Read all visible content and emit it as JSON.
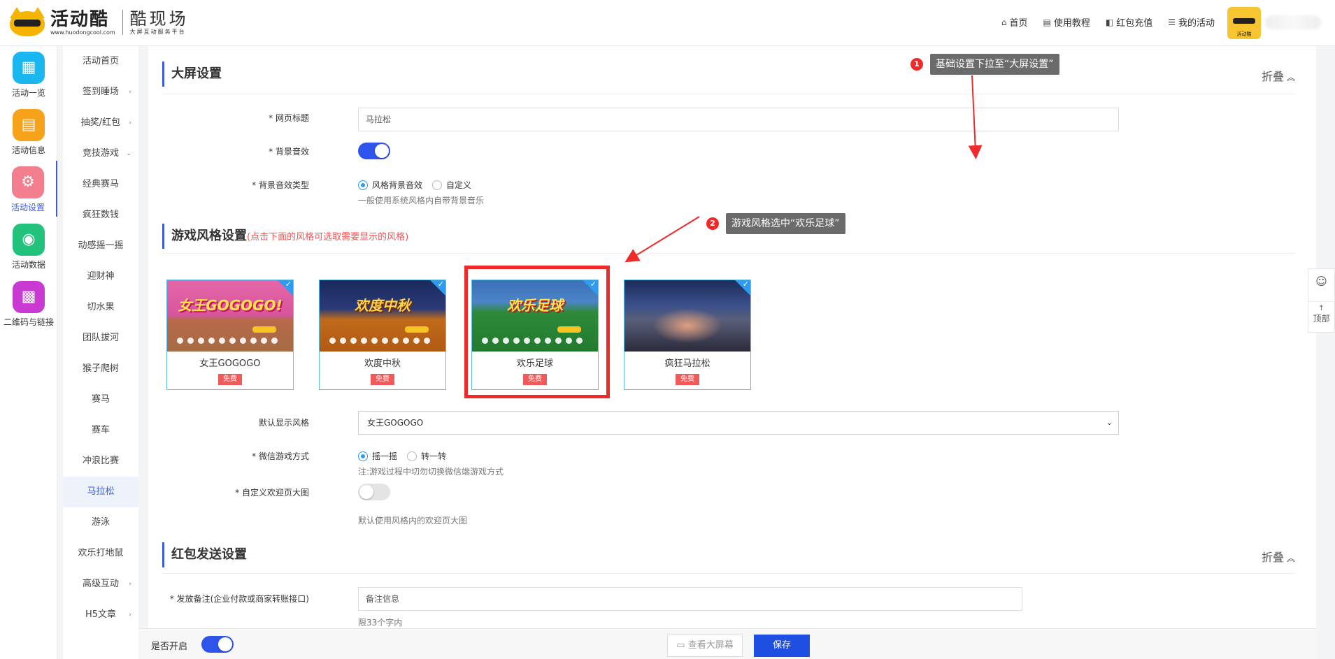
{
  "header": {
    "logo_cn": "活动酷",
    "logo_url": "www.huodongcool.com",
    "sub_title": "酷现场",
    "sub_desc": "大屏互动服务平台",
    "avatar_text": "活动酷",
    "nav": [
      {
        "icon": "⌂",
        "label": "首页"
      },
      {
        "icon": "▤",
        "label": "使用教程"
      },
      {
        "icon": "◧",
        "label": "红包充值"
      },
      {
        "icon": "☰",
        "label": "我的活动"
      }
    ]
  },
  "iconbar": {
    "items": [
      {
        "label": "活动一览",
        "glyph": "▦",
        "color": "#1ab6f0"
      },
      {
        "label": "活动信息",
        "glyph": "▤",
        "color": "#f7a21b"
      },
      {
        "label": "活动设置",
        "glyph": "⚙",
        "color": "#f27e8e"
      },
      {
        "label": "活动数据",
        "glyph": "◉",
        "color": "#22c27c"
      },
      {
        "label": "二维码与链接",
        "glyph": "▩",
        "color": "#c83ad1"
      }
    ]
  },
  "submenu": {
    "items": [
      {
        "label": "活动首页",
        "arrow": ""
      },
      {
        "label": "签到睡场",
        "arrow": "›"
      },
      {
        "label": "抽奖/红包",
        "arrow": "›"
      },
      {
        "label": "竞技游戏",
        "arrow": "⌄"
      },
      {
        "label": "经典赛马",
        "arrow": ""
      },
      {
        "label": "疯狂数钱",
        "arrow": ""
      },
      {
        "label": "动感摇一摇",
        "arrow": ""
      },
      {
        "label": "迎财神",
        "arrow": ""
      },
      {
        "label": "切水果",
        "arrow": ""
      },
      {
        "label": "团队拔河",
        "arrow": ""
      },
      {
        "label": "猴子爬树",
        "arrow": ""
      },
      {
        "label": "赛马",
        "arrow": ""
      },
      {
        "label": "赛车",
        "arrow": ""
      },
      {
        "label": "冲浪比赛",
        "arrow": ""
      },
      {
        "label": "马拉松",
        "arrow": ""
      },
      {
        "label": "游泳",
        "arrow": ""
      },
      {
        "label": "欢乐打地鼠",
        "arrow": ""
      },
      {
        "label": "高级互动",
        "arrow": "›"
      },
      {
        "label": "H5文章",
        "arrow": "›"
      }
    ]
  },
  "big_screen": {
    "title": "大屏设置",
    "collapse": "折叠",
    "page_title_label": "* 网页标题",
    "page_title_value": "马拉松",
    "bg_sound_label": "* 背景音效",
    "bg_sound_on": true,
    "bg_sound_type_label": "* 背景音效类型",
    "bg_sound_options": [
      "风格背景音效",
      "自定义"
    ],
    "bg_sound_help": "一般使用系统风格内自带背景音乐"
  },
  "game_style": {
    "title": "游戏风格设置",
    "hint": "(点击下面的风格可选取需要显示的风格)",
    "styles": [
      {
        "name": "女王GOGOGO",
        "free": "免费",
        "thumb_title": "女王GOGOGO!"
      },
      {
        "name": "欢度中秋",
        "free": "免费",
        "thumb_title": "欢度中秋"
      },
      {
        "name": "欢乐足球",
        "free": "免费",
        "thumb_title": "欢乐足球"
      },
      {
        "name": "疯狂马拉松",
        "free": "免费",
        "thumb_title": ""
      }
    ],
    "default_label": "默认显示风格",
    "default_value": "女王GOGOGO",
    "wechat_label": "* 微信游戏方式",
    "wechat_options": [
      "摇一摇",
      "转一转"
    ],
    "wechat_help": "注:游戏过程中切勿切换微信端游戏方式",
    "welcome_label": "* 自定义欢迎页大图",
    "welcome_on": false,
    "welcome_help": "默认使用风格内的欢迎页大图"
  },
  "redpacket": {
    "title": "红包发送设置",
    "collapse": "折叠",
    "remark_label": "* 发放备注(企业付款或商家转账接口)",
    "remark_placeholder": "备注信息",
    "remark_help": "限33个字内"
  },
  "bottombar": {
    "enable_label": "是否开启",
    "enable_on": true,
    "view_screen": "查看大屏幕",
    "save": "保存"
  },
  "annotations": [
    {
      "num": "1",
      "text": "基础设置下拉至“大屏设置”"
    },
    {
      "num": "2",
      "text": "游戏风格选中“欢乐足球”"
    }
  ],
  "float": {
    "qq_glyph": "☺",
    "top_label": "顶部",
    "top_glyph": "↑"
  }
}
